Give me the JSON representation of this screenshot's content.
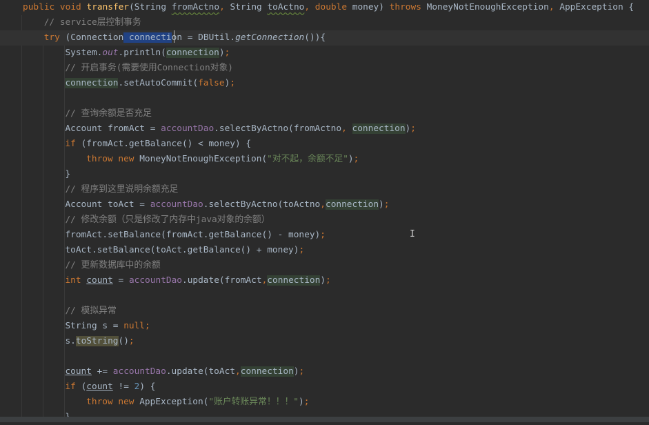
{
  "colors": {
    "background": "#2b2b2b",
    "keyword": "#cc7832",
    "comment": "#808080",
    "method": "#ffc66d",
    "field": "#9876aa",
    "string": "#6a8759",
    "number": "#6897bb",
    "selection": "#214283",
    "usage_highlight": "#344134",
    "warning": "#52503a"
  },
  "cursor_icon": "text-cursor-icon",
  "mouse_glyph": "I",
  "lines": [
    {
      "indent": 0,
      "tokens": [
        [
          "public void ",
          "kw"
        ],
        [
          "transfer",
          "fn"
        ],
        [
          "(String ",
          ""
        ],
        [
          "fromActno",
          "wavy"
        ],
        [
          ", ",
          "kw"
        ],
        [
          "String ",
          ""
        ],
        [
          "toActno",
          "wavy"
        ],
        [
          ", ",
          "kw"
        ],
        [
          "double",
          "kw"
        ],
        [
          " money) ",
          ""
        ],
        [
          "throws",
          "kw"
        ],
        [
          " MoneyNotEnoughException",
          ""
        ],
        [
          ", ",
          "kw"
        ],
        [
          "AppException {",
          ""
        ]
      ]
    },
    {
      "indent": 1,
      "tokens": [
        [
          "// service层控制事务",
          "cm"
        ]
      ]
    },
    {
      "indent": 1,
      "current": true,
      "tokens": [
        [
          "try",
          "kw"
        ],
        [
          " (Connection",
          ""
        ],
        [
          " connecti",
          "sel"
        ],
        [
          "on = DBUtil.",
          ""
        ],
        [
          "getConnection",
          "it"
        ],
        [
          "()){",
          ""
        ]
      ]
    },
    {
      "indent": 2,
      "tokens": [
        [
          "System.",
          ""
        ],
        [
          "out",
          "fldi"
        ],
        [
          ".println(",
          ""
        ],
        [
          "connection",
          "hl"
        ],
        [
          ")",
          ""
        ],
        [
          ";",
          "kw"
        ]
      ]
    },
    {
      "indent": 2,
      "tokens": [
        [
          "// 开启事务(需要使用Connection对象)",
          "cm"
        ]
      ]
    },
    {
      "indent": 2,
      "tokens": [
        [
          "connection",
          "hl"
        ],
        [
          ".setAutoCommit(",
          ""
        ],
        [
          "false",
          "kw"
        ],
        [
          ")",
          ""
        ],
        [
          ";",
          "kw"
        ]
      ]
    },
    {
      "indent": 2,
      "tokens": []
    },
    {
      "indent": 2,
      "tokens": [
        [
          "// 查询余额是否充足",
          "cm"
        ]
      ]
    },
    {
      "indent": 2,
      "tokens": [
        [
          "Account fromAct = ",
          ""
        ],
        [
          "accountDao",
          "fld"
        ],
        [
          ".selectByActno(fromActno",
          ""
        ],
        [
          ", ",
          "kw"
        ],
        [
          "connection",
          "hl"
        ],
        [
          ")",
          ""
        ],
        [
          ";",
          "kw"
        ]
      ]
    },
    {
      "indent": 2,
      "tokens": [
        [
          "if",
          "kw"
        ],
        [
          " (fromAct.getBalance() < money) {",
          ""
        ]
      ]
    },
    {
      "indent": 3,
      "tokens": [
        [
          "throw new ",
          "kw"
        ],
        [
          "MoneyNotEnoughException(",
          ""
        ],
        [
          "\"对不起，余额不足\"",
          "str"
        ],
        [
          ")",
          ""
        ],
        [
          ";",
          "kw"
        ]
      ]
    },
    {
      "indent": 2,
      "tokens": [
        [
          "}",
          ""
        ]
      ]
    },
    {
      "indent": 2,
      "tokens": [
        [
          "// 程序到这里说明余额充足",
          "cm"
        ]
      ]
    },
    {
      "indent": 2,
      "tokens": [
        [
          "Account toAct = ",
          ""
        ],
        [
          "accountDao",
          "fld"
        ],
        [
          ".selectByActno(toActno",
          ""
        ],
        [
          ",",
          "kw"
        ],
        [
          "connection",
          "hl"
        ],
        [
          ")",
          ""
        ],
        [
          ";",
          "kw"
        ]
      ]
    },
    {
      "indent": 2,
      "tokens": [
        [
          "// 修改余额（只是修改了内存中java对象的余额）",
          "cm"
        ]
      ]
    },
    {
      "indent": 2,
      "tokens": [
        [
          "fromAct.setBalance(fromAct.getBalance() - money)",
          ""
        ],
        [
          ";",
          "kw"
        ]
      ]
    },
    {
      "indent": 2,
      "tokens": [
        [
          "toAct.setBalance(toAct.getBalance() + money)",
          ""
        ],
        [
          ";",
          "kw"
        ]
      ]
    },
    {
      "indent": 2,
      "tokens": [
        [
          "// 更新数据库中的余额",
          "cm"
        ]
      ]
    },
    {
      "indent": 2,
      "tokens": [
        [
          "int",
          "kw"
        ],
        [
          " ",
          ""
        ],
        [
          "count",
          "ul"
        ],
        [
          " = ",
          ""
        ],
        [
          "accountDao",
          "fld"
        ],
        [
          ".update(fromAct",
          ""
        ],
        [
          ",",
          "kw"
        ],
        [
          "connection",
          "hl"
        ],
        [
          ")",
          ""
        ],
        [
          ";",
          "kw"
        ]
      ]
    },
    {
      "indent": 2,
      "tokens": []
    },
    {
      "indent": 2,
      "tokens": [
        [
          "// 模拟异常",
          "cm"
        ]
      ]
    },
    {
      "indent": 2,
      "tokens": [
        [
          "String s = ",
          ""
        ],
        [
          "null",
          "kw"
        ],
        [
          ";",
          "kw"
        ]
      ]
    },
    {
      "indent": 2,
      "tokens": [
        [
          "s.",
          ""
        ],
        [
          "toString",
          "warn"
        ],
        [
          "()",
          ""
        ],
        [
          ";",
          "kw"
        ]
      ]
    },
    {
      "indent": 2,
      "tokens": []
    },
    {
      "indent": 2,
      "tokens": [
        [
          "count",
          "ul"
        ],
        [
          " += ",
          ""
        ],
        [
          "accountDao",
          "fld"
        ],
        [
          ".update(toAct",
          ""
        ],
        [
          ",",
          "kw"
        ],
        [
          "connection",
          "hl"
        ],
        [
          ")",
          ""
        ],
        [
          ";",
          "kw"
        ]
      ]
    },
    {
      "indent": 2,
      "tokens": [
        [
          "if",
          "kw"
        ],
        [
          " (",
          ""
        ],
        [
          "count",
          "ul"
        ],
        [
          " != ",
          ""
        ],
        [
          "2",
          "num"
        ],
        [
          ") {",
          ""
        ]
      ]
    },
    {
      "indent": 3,
      "tokens": [
        [
          "throw new ",
          "kw"
        ],
        [
          "AppException(",
          ""
        ],
        [
          "\"账户转账异常！！！\"",
          "str"
        ],
        [
          ")",
          ""
        ],
        [
          ";",
          "kw"
        ]
      ]
    },
    {
      "indent": 2,
      "tokens": [
        [
          "}",
          ""
        ]
      ]
    }
  ]
}
